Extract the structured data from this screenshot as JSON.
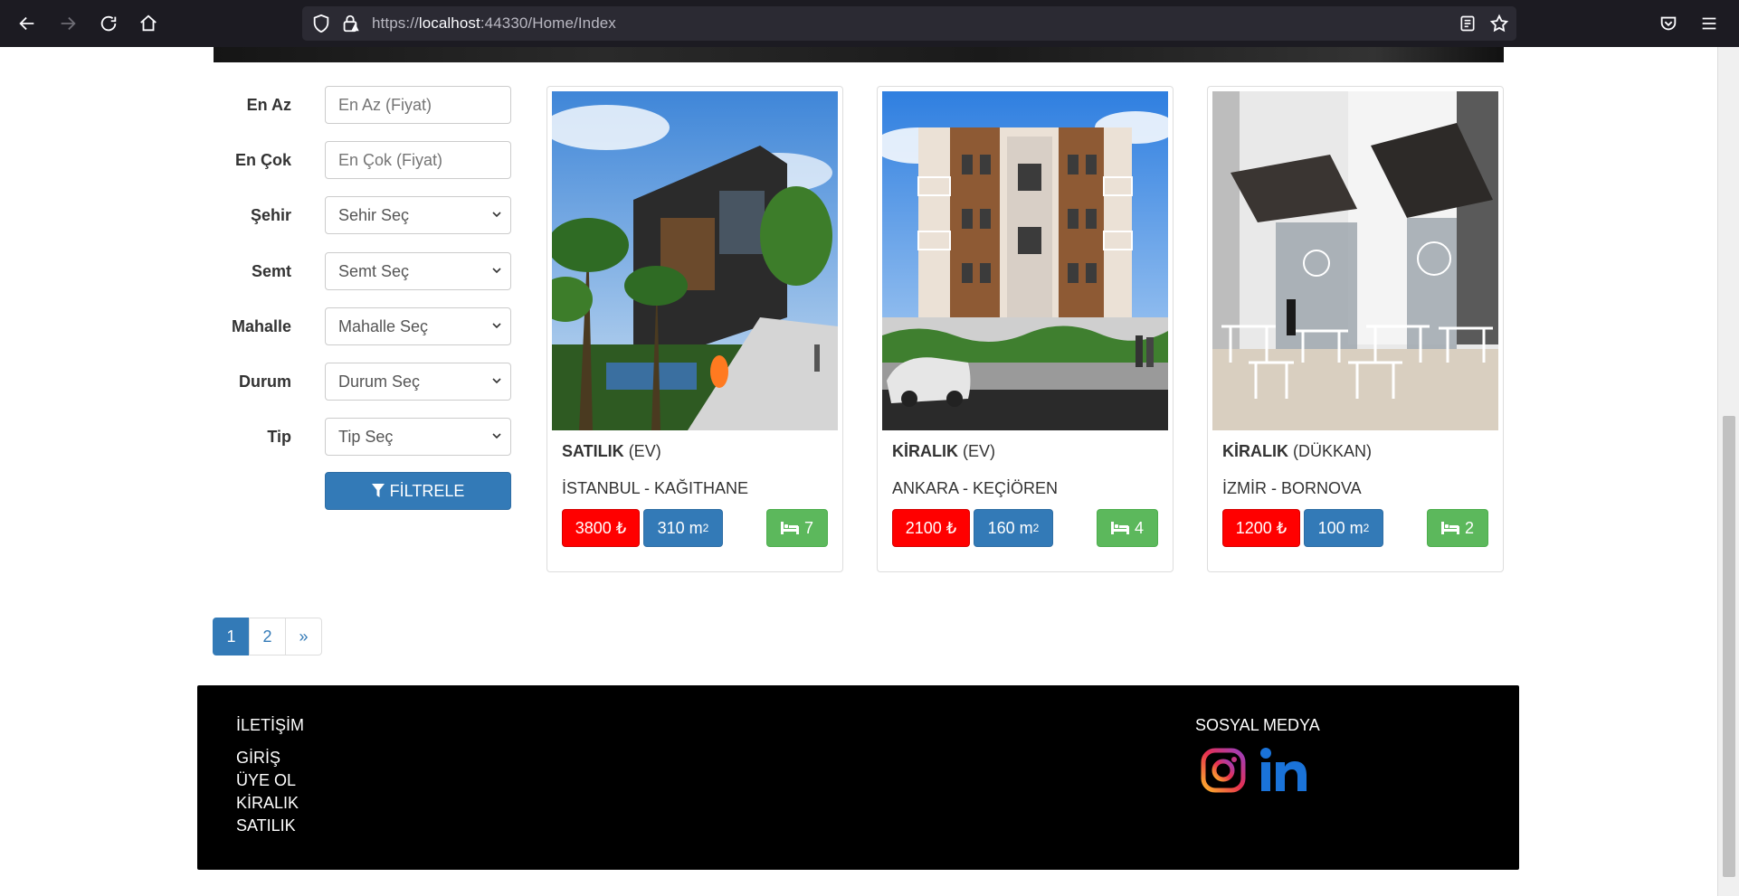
{
  "browser": {
    "url_scheme": "https://",
    "url_host": "localhost",
    "url_rest": ":44330/Home/Index"
  },
  "filters": [
    {
      "label": "En Az",
      "type": "input",
      "placeholder": "En Az (Fiyat)"
    },
    {
      "label": "En Çok",
      "type": "input",
      "placeholder": "En Çok (Fiyat)"
    },
    {
      "label": "Şehir",
      "type": "select",
      "value": "Sehir Seç"
    },
    {
      "label": "Semt",
      "type": "select",
      "value": "Semt Seç"
    },
    {
      "label": "Mahalle",
      "type": "select",
      "value": "Mahalle Seç"
    },
    {
      "label": "Durum",
      "type": "select",
      "value": "Durum Seç"
    },
    {
      "label": "Tip",
      "type": "select",
      "value": "Tip Seç"
    }
  ],
  "filter_button": {
    "label": "FİLTRELE",
    "icon": "filter-icon"
  },
  "listings": [
    {
      "status": "SATILIK",
      "type": "(EV)",
      "location": "İSTANBUL - KAĞITHANE",
      "price": "3800 ₺",
      "area": "310 m",
      "area_unit_sup": "2",
      "rooms": "7",
      "image": "villa-with-palm-trees"
    },
    {
      "status": "KİRALIK",
      "type": "(EV)",
      "location": "ANKARA - KEÇİÖREN",
      "price": "2100 ₺",
      "area": "160 m",
      "area_unit_sup": "2",
      "rooms": "4",
      "image": "apartment-building"
    },
    {
      "status": "KİRALIK",
      "type": "(DÜKKAN)",
      "location": "İZMİR - BORNOVA",
      "price": "1200 ₺",
      "area": "100 m",
      "area_unit_sup": "2",
      "rooms": "2",
      "image": "coffee-shop-storefront"
    }
  ],
  "pagination": {
    "pages": [
      "1",
      "2"
    ],
    "next": "»",
    "current": "1"
  },
  "footer": {
    "contact_heading": "İLETİŞİM",
    "links": [
      "GİRİŞ",
      "ÜYE OL",
      "KİRALIK",
      "SATILIK"
    ],
    "social_heading": "SOSYAL MEDYA",
    "social_icons": [
      "instagram-icon",
      "linkedin-icon"
    ]
  },
  "colors": {
    "primary": "#337ab7",
    "price": "#ff0000",
    "rooms": "#5cb85c",
    "footer_bg": "#000000"
  }
}
